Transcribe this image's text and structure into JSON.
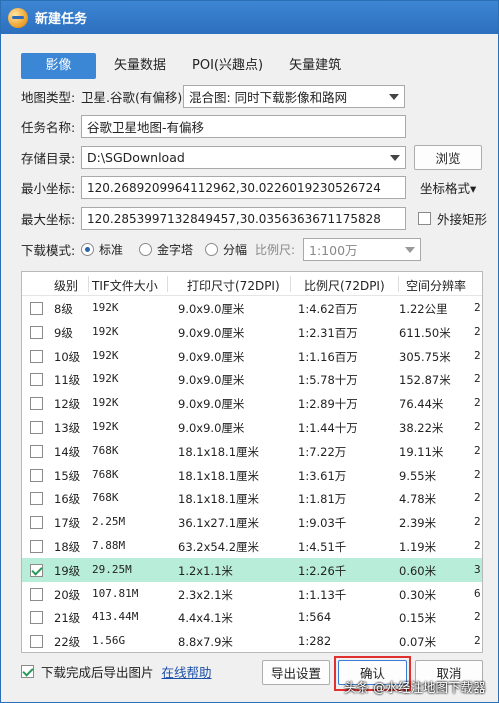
{
  "window": {
    "title": "新建任务"
  },
  "tabs": [
    {
      "label": "影像",
      "active": true
    },
    {
      "label": "矢量数据",
      "active": false
    },
    {
      "label": "POI(兴趣点)",
      "active": false
    },
    {
      "label": "矢量建筑",
      "active": false
    }
  ],
  "form": {
    "map_type_label": "地图类型:",
    "map_type_value": "卫星.谷歌(有偏移)",
    "map_mode_value": "混合图: 同时下载影像和路网",
    "task_name_label": "任务名称:",
    "task_name_value": "谷歌卫星地图-有偏移",
    "storage_label": "存储目录:",
    "storage_value": "D:\\SGDownload",
    "browse_label": "浏览",
    "min_coord_label": "最小坐标:",
    "min_coord_value": "120.2689209964112962,30.0226019230526724",
    "coord_format_label": "坐标格式▾",
    "max_coord_label": "最大坐标:",
    "max_coord_value": "120.2853997132849457,30.0356363671175828",
    "outer_rect_label": "外接矩形",
    "download_mode_label": "下载模式:",
    "mode_standard": "标准",
    "mode_pyramid": "金字塔",
    "mode_split": "分幅",
    "scale_label": "比例尺:",
    "scale_value": "1:100万"
  },
  "table": {
    "headers": [
      "级别",
      "TIF文件大小",
      "打印尺寸(72DPI)",
      "比例尺(72DPI)",
      "空间分辨率"
    ],
    "rows": [
      {
        "checked": false,
        "level": "8级",
        "size": "192K",
        "print": "9.0x9.0厘米",
        "scale": "1:4.62百万",
        "res": "1.22公里",
        "extra": "2"
      },
      {
        "checked": false,
        "level": "9级",
        "size": "192K",
        "print": "9.0x9.0厘米",
        "scale": "1:2.31百万",
        "res": "611.50米",
        "extra": "2"
      },
      {
        "checked": false,
        "level": "10级",
        "size": "192K",
        "print": "9.0x9.0厘米",
        "scale": "1:1.16百万",
        "res": "305.75米",
        "extra": "2"
      },
      {
        "checked": false,
        "level": "11级",
        "size": "192K",
        "print": "9.0x9.0厘米",
        "scale": "1:5.78十万",
        "res": "152.87米",
        "extra": "2"
      },
      {
        "checked": false,
        "level": "12级",
        "size": "192K",
        "print": "9.0x9.0厘米",
        "scale": "1:2.89十万",
        "res": "76.44米",
        "extra": "2"
      },
      {
        "checked": false,
        "level": "13级",
        "size": "192K",
        "print": "9.0x9.0厘米",
        "scale": "1:1.44十万",
        "res": "38.22米",
        "extra": "2"
      },
      {
        "checked": false,
        "level": "14级",
        "size": "768K",
        "print": "18.1x18.1厘米",
        "scale": "1:7.22万",
        "res": "19.11米",
        "extra": "2"
      },
      {
        "checked": false,
        "level": "15级",
        "size": "768K",
        "print": "18.1x18.1厘米",
        "scale": "1:3.61万",
        "res": "9.55米",
        "extra": "2"
      },
      {
        "checked": false,
        "level": "16级",
        "size": "768K",
        "print": "18.1x18.1厘米",
        "scale": "1:1.81万",
        "res": "4.78米",
        "extra": "2"
      },
      {
        "checked": false,
        "level": "17级",
        "size": "2.25M",
        "print": "36.1x27.1厘米",
        "scale": "1:9.03千",
        "res": "2.39米",
        "extra": "2"
      },
      {
        "checked": false,
        "level": "18级",
        "size": "7.88M",
        "print": "63.2x54.2厘米",
        "scale": "1:4.51千",
        "res": "1.19米",
        "extra": "2"
      },
      {
        "checked": true,
        "level": "19级",
        "size": "29.25M",
        "print": "1.2x1.1米",
        "scale": "1:2.26千",
        "res": "0.60米",
        "extra": "3"
      },
      {
        "checked": false,
        "level": "20级",
        "size": "107.81M",
        "print": "2.3x2.1米",
        "scale": "1:1.13千",
        "res": "0.30米",
        "extra": "6"
      },
      {
        "checked": false,
        "level": "21级",
        "size": "413.44M",
        "print": "4.4x4.1米",
        "scale": "1:564",
        "res": "0.15米",
        "extra": "2"
      },
      {
        "checked": false,
        "level": "22级",
        "size": "1.56G",
        "print": "8.8x7.9米",
        "scale": "1:282",
        "res": "0.07米",
        "extra": "2"
      }
    ]
  },
  "footer": {
    "export_after_label": "下载完成后导出图片",
    "help_link": "在线帮助",
    "export_settings": "导出设置",
    "confirm": "确认",
    "cancel": "取消",
    "watermark": "头条 @水经注地图下载器"
  },
  "colors": {
    "accent": "#3b87d6",
    "highlight_row": "#b8eed9",
    "confirm_outline": "#e03030"
  }
}
